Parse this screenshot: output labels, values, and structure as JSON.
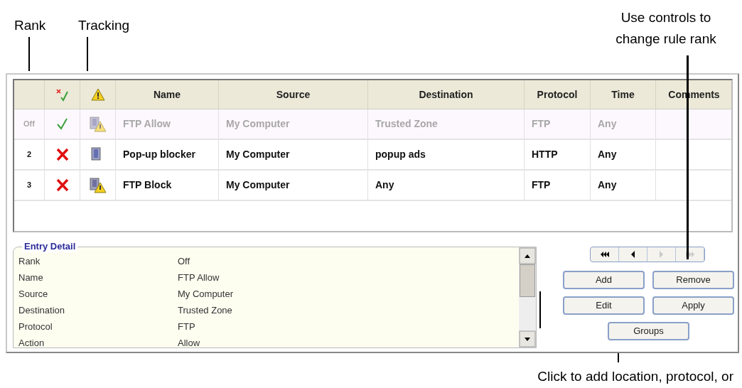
{
  "callouts": [
    {
      "text": "Rank",
      "kind": "rank"
    },
    {
      "text": "Tracking",
      "kind": "tracking"
    },
    {
      "text": "Use controls to change rule rank",
      "kind": "controls"
    },
    {
      "text": "Click to add location, protocol, or",
      "kind": "groups"
    }
  ],
  "table": {
    "columns": [
      {
        "kind": "blank"
      },
      {
        "kind": "status-icon"
      },
      {
        "kind": "tracking-icon"
      },
      {
        "kind": "text",
        "label": "Name"
      },
      {
        "kind": "text",
        "label": "Source"
      },
      {
        "kind": "text",
        "label": "Destination"
      },
      {
        "kind": "text",
        "label": "Protocol"
      },
      {
        "kind": "text",
        "label": "Time"
      },
      {
        "kind": "text",
        "label": "Comments"
      }
    ],
    "rows": [
      {
        "rank": "Off",
        "enabled": false,
        "status": {
          "kind": "allow"
        },
        "tracking": {
          "kind": "page-warning"
        },
        "name": "FTP Allow",
        "source": "My Computer",
        "destination": "Trusted Zone",
        "protocol": "FTP",
        "time": "Any"
      },
      {
        "rank": "2",
        "enabled": true,
        "status": {
          "kind": "block"
        },
        "tracking": {
          "kind": "page"
        },
        "name": "Pop-up blocker",
        "source": "My Computer",
        "destination": "popup ads",
        "protocol": "HTTP",
        "time": "Any"
      },
      {
        "rank": "3",
        "enabled": true,
        "status": {
          "kind": "block"
        },
        "tracking": {
          "kind": "page-warning"
        },
        "name": "FTP Block",
        "source": "My Computer",
        "destination": "Any",
        "protocol": "FTP",
        "time": "Any"
      }
    ]
  },
  "entry_detail": {
    "title": "Entry Detail",
    "fields": [
      {
        "label": "Rank",
        "value": "Off"
      },
      {
        "label": "Name",
        "value": "FTP Allow"
      },
      {
        "label": "Source",
        "value": "My Computer"
      },
      {
        "label": "Destination",
        "value": "Trusted Zone"
      },
      {
        "label": "Protocol",
        "value": "FTP"
      },
      {
        "label": "Action",
        "value": "Allow"
      }
    ]
  },
  "rank_controls": [
    {
      "kind": "first",
      "disabled": false
    },
    {
      "kind": "previous",
      "disabled": false
    },
    {
      "kind": "next",
      "disabled": true
    },
    {
      "kind": "last",
      "disabled": true
    }
  ],
  "buttons": [
    "Add",
    "Remove",
    "Edit",
    "Apply",
    "Groups"
  ]
}
